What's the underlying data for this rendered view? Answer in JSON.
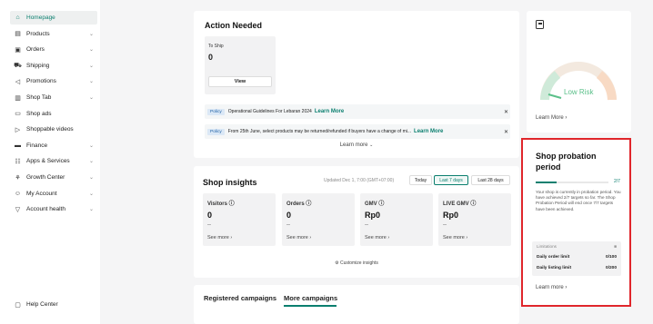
{
  "sidebar": {
    "items": [
      {
        "label": "Homepage",
        "icon": "home-icon",
        "glyph": "⌂",
        "chevron": false,
        "active": true
      },
      {
        "label": "Products",
        "icon": "box-icon",
        "glyph": "▤",
        "chevron": true
      },
      {
        "label": "Orders",
        "icon": "clipboard-icon",
        "glyph": "▣",
        "chevron": true
      },
      {
        "label": "Shipping",
        "icon": "truck-icon",
        "glyph": "⛟",
        "chevron": true
      },
      {
        "label": "Promotions",
        "icon": "megaphone-icon",
        "glyph": "◁",
        "chevron": true
      },
      {
        "label": "Shop Tab",
        "icon": "shop-icon",
        "glyph": "▥",
        "chevron": true
      },
      {
        "label": "Shop ads",
        "icon": "ad-icon",
        "glyph": "▭",
        "chevron": false
      },
      {
        "label": "Shoppable videos",
        "icon": "video-icon",
        "glyph": "▷",
        "chevron": false
      },
      {
        "label": "Finance",
        "icon": "wallet-icon",
        "glyph": "▬",
        "chevron": true
      },
      {
        "label": "Apps & Services",
        "icon": "apps-icon",
        "glyph": "☷",
        "chevron": true
      },
      {
        "label": "Growth Center",
        "icon": "growth-icon",
        "glyph": "⚘",
        "chevron": true
      },
      {
        "label": "My Account",
        "icon": "user-icon",
        "glyph": "☺",
        "chevron": true
      },
      {
        "label": "Account health",
        "icon": "shield-icon",
        "glyph": "▽",
        "chevron": true
      }
    ],
    "help_center": "Help Center"
  },
  "action_needed": {
    "title": "Action Needed",
    "to_ship_label": "To Ship",
    "to_ship_value": "0",
    "view_label": "View",
    "policies": [
      {
        "tag": "Policy",
        "text": "Operational Guidelines For Lebaran 2024",
        "link": "Learn More"
      },
      {
        "tag": "Policy",
        "text": "From 25th June, select products may be returned/refunded if buyers have a change of mi...",
        "link": "Learn More"
      }
    ],
    "learn_more": "Learn more"
  },
  "shop_insights": {
    "title": "Shop insights",
    "updated": "Updated Dec 1, 7:00 (GMT+07:00)",
    "ranges": [
      "Today",
      "Last 7 days",
      "Last 28 days"
    ],
    "selected_range": "Last 7 days",
    "metrics": [
      {
        "label": "Visitors",
        "value": "0",
        "dash": "--",
        "more": "See more"
      },
      {
        "label": "Orders",
        "value": "0",
        "dash": "--",
        "more": "See more"
      },
      {
        "label": "GMV",
        "value": "Rp0",
        "dash": "--",
        "more": "See more"
      },
      {
        "label": "LIVE GMV",
        "value": "Rp0",
        "dash": "--",
        "more": "See more"
      }
    ],
    "customize": "Customize insights"
  },
  "campaigns": {
    "tabs": [
      "Registered campaigns",
      "More campaigns"
    ],
    "active_tab": "More campaigns"
  },
  "health": {
    "risk_label": "Low Risk",
    "learn_more": "Learn More"
  },
  "probation": {
    "title": "Shop probation period",
    "progress_text": "2/7",
    "progress": 0.286,
    "description": "Your shop is currently in probation period. You have achieved 2/7 targets so far. The Shop Probation Period will end once 7/7 targets have been achieved.",
    "limitations_label": "Limitations",
    "limits": [
      {
        "label": "Daily order limit",
        "value": "0/100"
      },
      {
        "label": "Daily listing limit",
        "value": "0/200"
      }
    ],
    "learn_more": "Learn more"
  },
  "colors": {
    "accent": "#0b7f6f",
    "highlight_border": "#e0262b",
    "gauge_green": "#5cc08a"
  }
}
